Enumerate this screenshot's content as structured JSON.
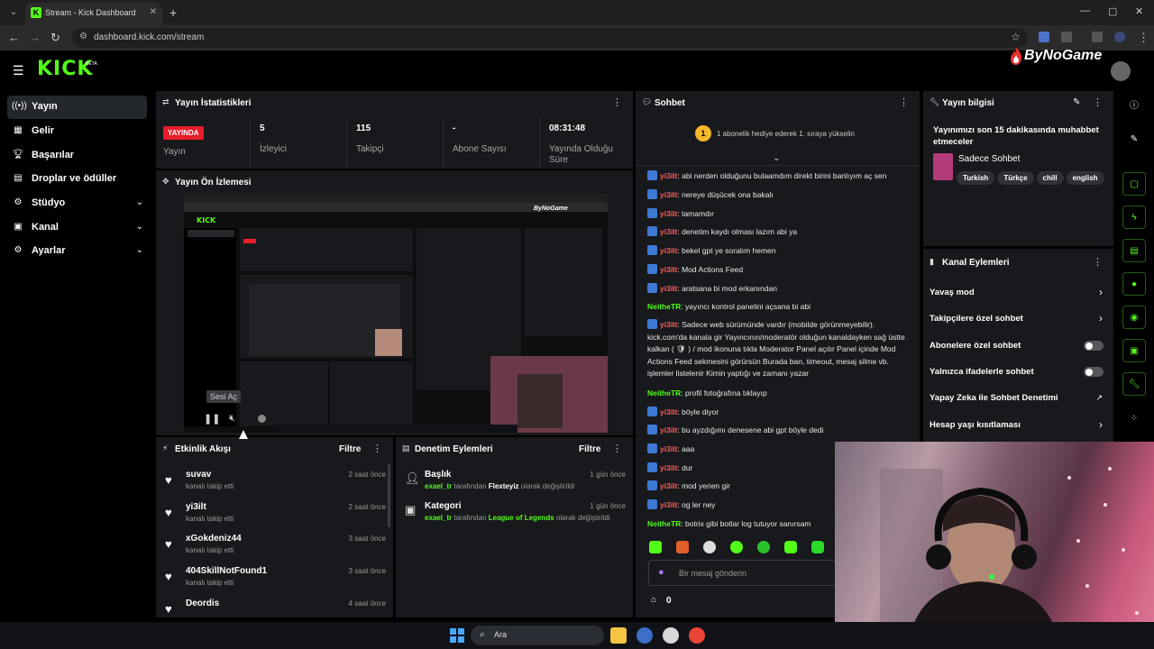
{
  "browser": {
    "tab_title": "Stream - Kick Dashboard",
    "url": "dashboard.kick.com/stream"
  },
  "header": {
    "logo": "KICK",
    "beta": "BETA",
    "watermark": "ByNoGame"
  },
  "sidebar": {
    "items": [
      {
        "label": "Yayın",
        "icon": "broadcast-icon"
      },
      {
        "label": "Gelir",
        "icon": "revenue-icon"
      },
      {
        "label": "Başarılar",
        "icon": "trophy-icon"
      },
      {
        "label": "Droplar ve ödüller",
        "icon": "gift-icon"
      },
      {
        "label": "Stüdyo",
        "icon": "studio-icon"
      },
      {
        "label": "Kanal",
        "icon": "channel-icon"
      },
      {
        "label": "Ayarlar",
        "icon": "gear-icon"
      }
    ]
  },
  "stats": {
    "title": "Yayın İstatistikleri",
    "live_badge": "YAYINDA",
    "live_label": "Yayın",
    "viewers_value": "5",
    "viewers_label": "İzleyici",
    "followers_value": "115",
    "followers_label": "Takipçi",
    "subs_value": "-",
    "subs_label": "Abone Sayısı",
    "uptime_value": "08:31:48",
    "uptime_label": "Yayında Olduğu Süre"
  },
  "preview": {
    "title": "Yayın Ön İzlemesi",
    "tooltip": "Sesi Aç"
  },
  "activity": {
    "title": "Etkinlik Akışı",
    "filter": "Filtre",
    "items": [
      {
        "name": "suvav",
        "sub": "kanalı takip etti",
        "time": "2 saat önce"
      },
      {
        "name": "yi3ilt",
        "sub": "kanalı takip etti",
        "time": "2 saat önce"
      },
      {
        "name": "xGokdeniz44",
        "sub": "kanalı takip etti",
        "time": "3 saat önce"
      },
      {
        "name": "404SkillNotFound1",
        "sub": "kanalı takip etti",
        "time": "3 saat önce"
      },
      {
        "name": "Deordis",
        "sub": "",
        "time": "4 saat önce"
      }
    ]
  },
  "moderation": {
    "title": "Denetim Eylemleri",
    "filter": "Filtre",
    "items": [
      {
        "name": "Başlık",
        "user": "exael_tr",
        "mid": "tarafından",
        "value": "Flexteyiz",
        "end": "olarak değiştirildi",
        "time": "1 gün önce"
      },
      {
        "name": "Kategori",
        "user": "exael_tr",
        "mid": "tarafından",
        "value": "League of Legends",
        "end": "olarak değiştirildi",
        "time": "1 gün önce"
      }
    ]
  },
  "chat": {
    "title": "Sohbet",
    "gift_count": "1",
    "gift_text": "1 abonelik hediye ederek 1. sıraya yükselin",
    "messages": [
      {
        "user": "yi3ilt",
        "text": ": abi nerden olduğunu bulaamdım direkt birini banlıyım aç sen"
      },
      {
        "user": "yi3ilt",
        "text": ": nereye düşücek ona bakalı"
      },
      {
        "user": "yi3ilt",
        "text": ": tamamdır"
      },
      {
        "user": "yi3ilt",
        "text": ": denetim kaydı olması lazım abi ya"
      },
      {
        "user": "yi3ilt",
        "text": ": bekel gpt ye soralım hemen"
      },
      {
        "user": "yi3ilt",
        "text": ": Mod Actions Feed"
      },
      {
        "user": "yi3ilt",
        "text": ": aratsana bi mod erkanından"
      },
      {
        "user": "NeitheTR",
        "text": ": yayıncı kontrol panelini açsana bi abi",
        "streamer": true
      },
      {
        "user": "yi3ilt",
        "text": ": Sadece web sürümünde vardır (mobilde görünmeyebilir). kick.com'da kanala gir Yayıncının/moderatör olduğun kanaldayken sağ üstte kalkan ( 🛡 ) / mod ikonuna tıkla Moderator Panel açılır Panel içinde Mod Actions Feed sekmesini görürsün Burada ban, timeout, mesaj silme vb. işlemler listelenir Kimin yaptığı ve zamanı yazar"
      },
      {
        "user": "NeitheTR",
        "text": ": profil fotoğrafına tıklayıp",
        "streamer": true
      },
      {
        "user": "yi3ilt",
        "text": ": böyle diyor"
      },
      {
        "user": "yi3ilt",
        "text": ": bu ayzdığımı denesene abi gpt böyle dedi"
      },
      {
        "user": "yi3ilt",
        "text": ": aaa"
      },
      {
        "user": "yi3ilt",
        "text": ": dur"
      },
      {
        "user": "yi3ilt",
        "text": ": mod yerien gir"
      },
      {
        "user": "yi3ilt",
        "text": ": og ler ney"
      },
      {
        "user": "NeitheTR",
        "text": ": botrix gibi botlar log tutuyor sanırsam",
        "streamer": true
      }
    ],
    "input_placeholder": "Bir mesaj gönderin",
    "points": "0"
  },
  "stream_info": {
    "title": "Yayın bilgisi",
    "stream_title": "Yayınımızı son 15 dakikasında muhabbet etmeceler",
    "category": "Sadece Sohbet",
    "tags": [
      "Turkish",
      "Türkçe",
      "chill",
      "english"
    ]
  },
  "channel_actions": {
    "title": "Kanal Eylemleri",
    "items": [
      {
        "label": "Yavaş mod",
        "control": "chevron"
      },
      {
        "label": "Takipçilere özel sohbet",
        "control": "chevron"
      },
      {
        "label": "Abonelere özel sohbet",
        "control": "toggle"
      },
      {
        "label": "Yalnızca ifadelerle sohbet",
        "control": "toggle"
      },
      {
        "label": "Yapay Zeka ile Sohbet Denetimi",
        "control": "external"
      },
      {
        "label": "Hesap yaşı kısıtlaması",
        "control": "chevron"
      }
    ]
  },
  "taskbar": {
    "search": "Ara"
  },
  "colors": {
    "accent": "#53fc18",
    "live": "#e81d2a",
    "panel": "#18191c"
  }
}
